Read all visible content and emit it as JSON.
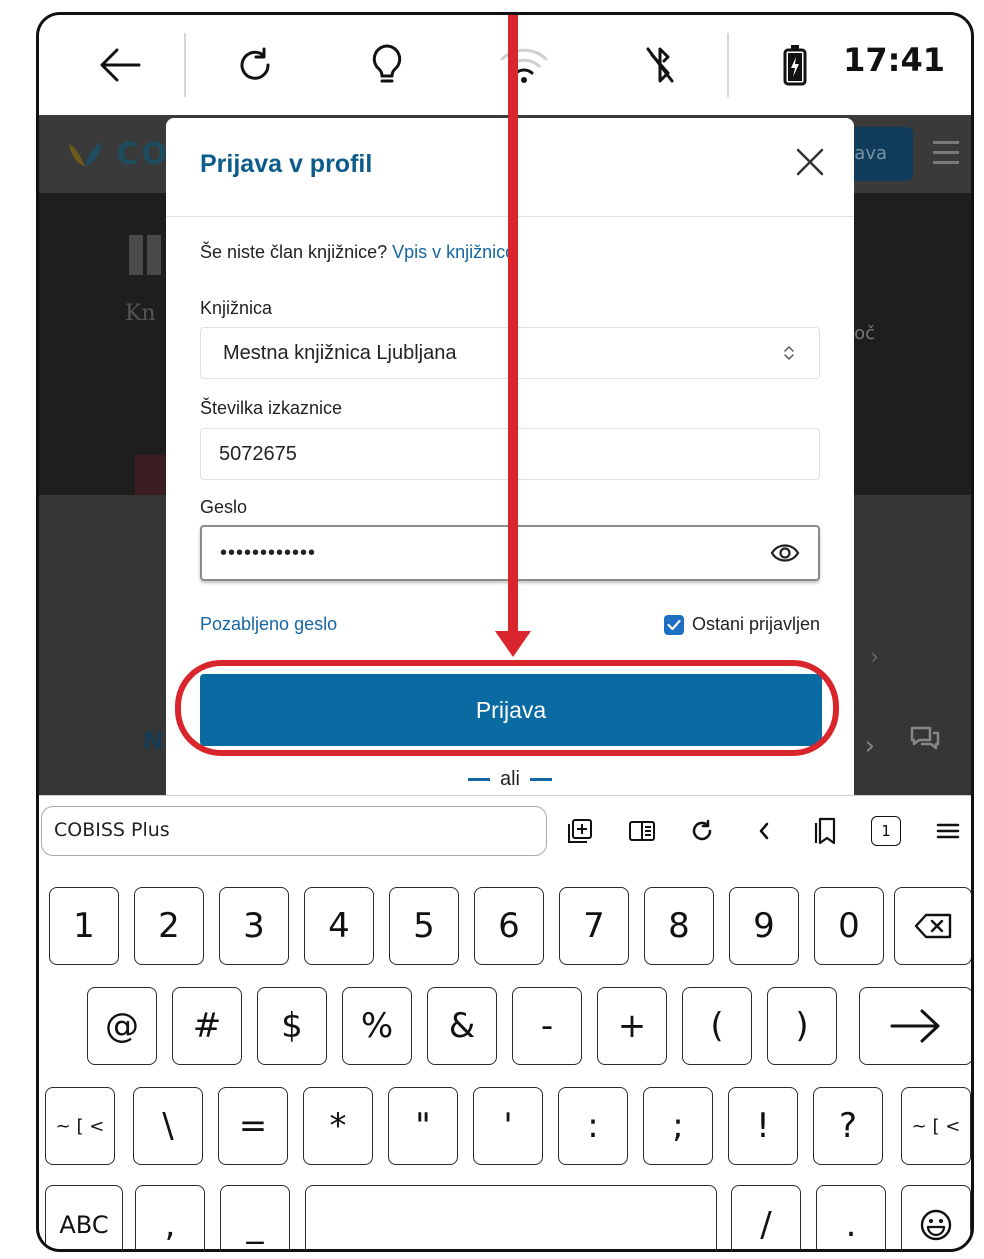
{
  "status_bar": {
    "time": "17:41",
    "icons": [
      "back-arrow-icon",
      "refresh-icon",
      "lightbulb-icon",
      "wifi-icon",
      "bluetooth-off-icon",
      "battery-charging-icon"
    ]
  },
  "web_page": {
    "logo_text": "COB",
    "login_button_text": "java",
    "hero_text": "Kn",
    "hero_right_text": "oč",
    "partial_heading": "N"
  },
  "modal": {
    "title": "Prijava v profil",
    "not_member_text": "Še niste član knjižnice?",
    "enroll_link": "Vpis v knjižnico",
    "library_label": "Knjižnica",
    "library_value": "Mestna knjižnica Ljubljana",
    "card_label": "Številka izkaznice",
    "card_value": "5072675",
    "password_label": "Geslo",
    "password_value": "••••••••••••",
    "forgot_link": "Pozabljeno geslo",
    "stay_logged_in_label": "Ostani prijavljen",
    "stay_logged_in_checked": true,
    "login_button": "Prijava",
    "or_text": "ali"
  },
  "annotation": {
    "color": "#d9262c",
    "target": "login-button"
  },
  "browser_toolbar": {
    "url_text": "COBISS Plus",
    "tab_count": "1",
    "icons": [
      "add-bookmark-icon",
      "reader-mode-icon",
      "reload-icon",
      "back-chevron-icon",
      "bookmark-icon",
      "tabs-icon",
      "menu-icon"
    ]
  },
  "keyboard": {
    "row1": [
      "1",
      "2",
      "3",
      "4",
      "5",
      "6",
      "7",
      "8",
      "9",
      "0"
    ],
    "row2": [
      "@",
      "#",
      "$",
      "%",
      "&",
      "-",
      "+",
      "(",
      ")"
    ],
    "row3_left": "~ [ <",
    "row3": [
      "\\",
      "=",
      "*",
      "\"",
      "'",
      ":",
      ";",
      "!",
      "?"
    ],
    "row3_right": "~ [ <",
    "row4_abc": "ABC",
    "row4": [
      ",",
      "_"
    ],
    "row4_right": [
      "/",
      "."
    ]
  },
  "colors": {
    "primary_blue": "#0a6aa2",
    "title_blue": "#0b5c8a",
    "link_blue": "#1466a5",
    "annotation_red": "#d9262c"
  }
}
